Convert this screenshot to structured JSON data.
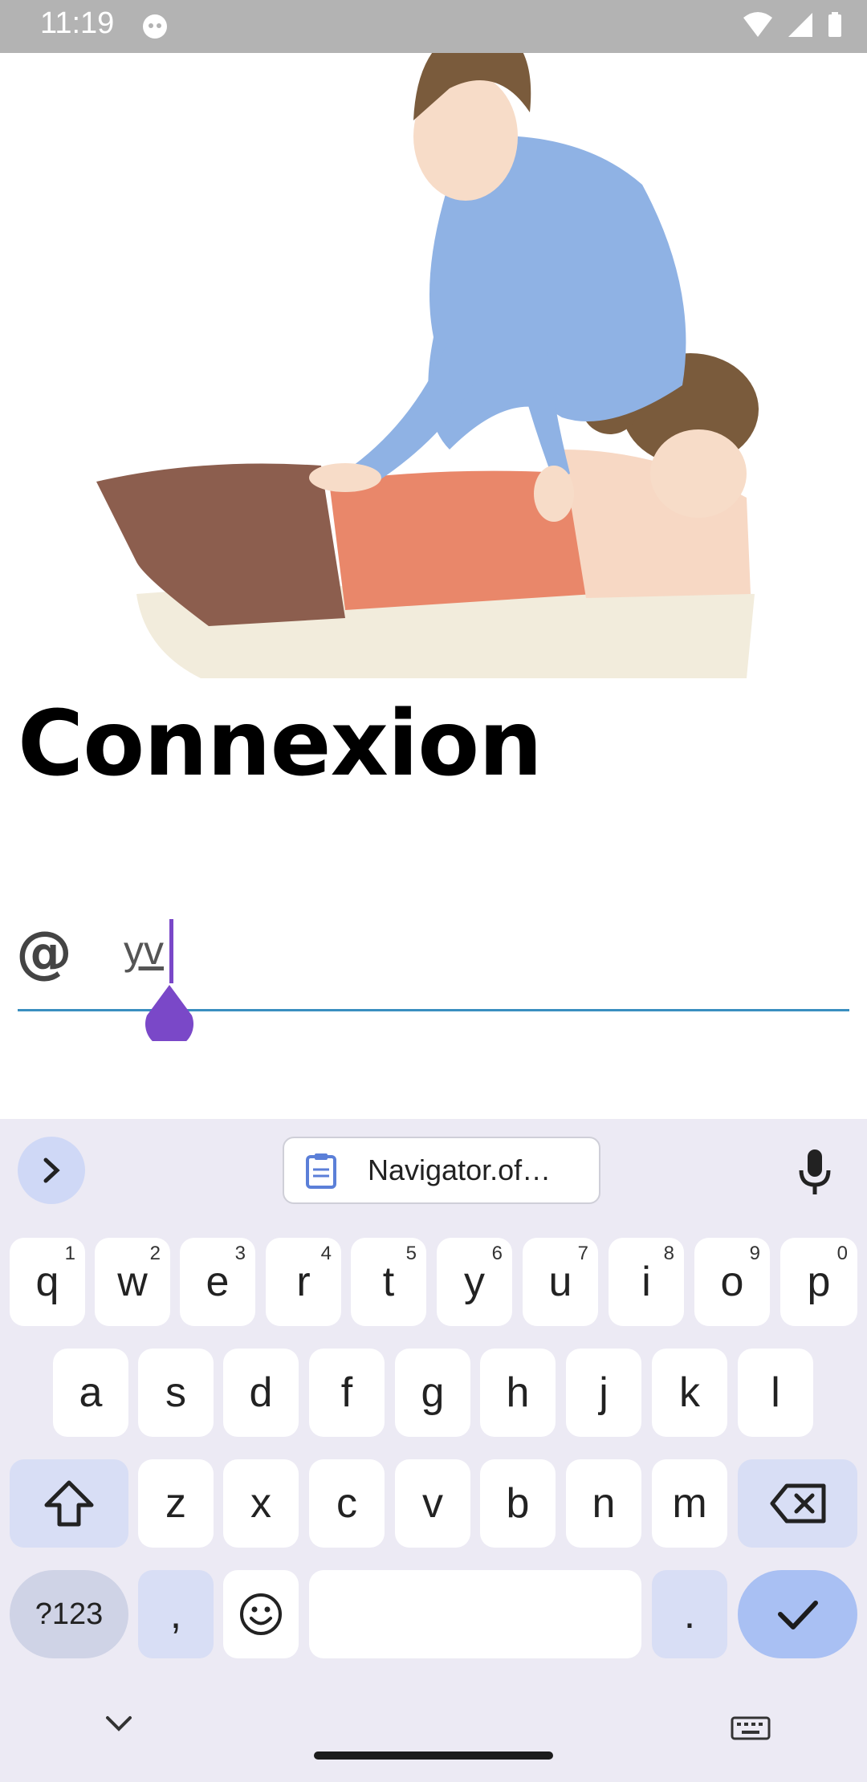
{
  "status_bar": {
    "time": "11:19"
  },
  "page": {
    "title": "Connexion"
  },
  "email_field": {
    "value": "yv",
    "leading_icon": "at-sign-icon"
  },
  "keyboard": {
    "clipboard_suggestion": "Navigator.of…",
    "row1": [
      {
        "key": "q",
        "hint": "1"
      },
      {
        "key": "w",
        "hint": "2"
      },
      {
        "key": "e",
        "hint": "3"
      },
      {
        "key": "r",
        "hint": "4"
      },
      {
        "key": "t",
        "hint": "5"
      },
      {
        "key": "y",
        "hint": "6"
      },
      {
        "key": "u",
        "hint": "7"
      },
      {
        "key": "i",
        "hint": "8"
      },
      {
        "key": "o",
        "hint": "9"
      },
      {
        "key": "p",
        "hint": "0"
      }
    ],
    "row2": [
      "a",
      "s",
      "d",
      "f",
      "g",
      "h",
      "j",
      "k",
      "l"
    ],
    "row3": [
      "z",
      "x",
      "c",
      "v",
      "b",
      "n",
      "m"
    ],
    "symbols_label": "?123",
    "comma": ",",
    "period": "."
  }
}
